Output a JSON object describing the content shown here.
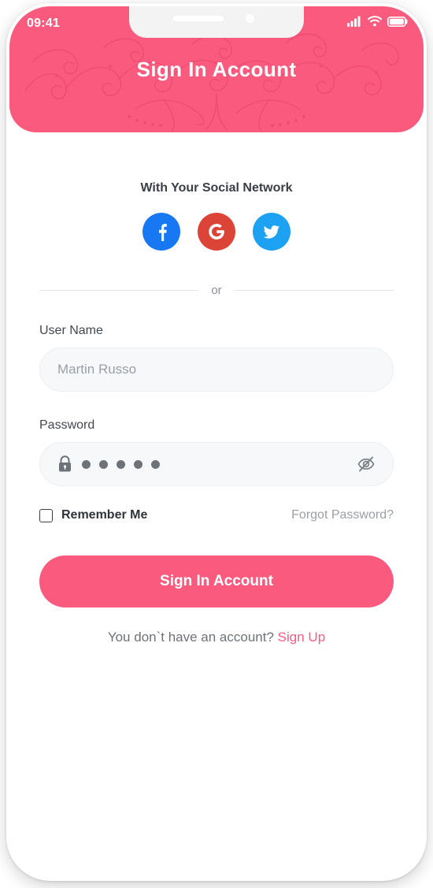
{
  "theme": {
    "accent_pink": "#FA5A7D",
    "facebook_blue": "#1877F2",
    "google_red": "#DB4437",
    "twitter_blue": "#1DA1F2",
    "input_bg": "#F6F8FA",
    "muted_text": "#9AA0A6"
  },
  "status_bar": {
    "time": "09:41",
    "icons": [
      "signal-icon",
      "wifi-icon",
      "battery-icon"
    ]
  },
  "header": {
    "title": "Sign In Account"
  },
  "social": {
    "title": "With Your Social Network",
    "buttons": [
      {
        "name": "facebook",
        "glyph": "f",
        "color": "#1877F2"
      },
      {
        "name": "google",
        "glyph": "G",
        "color": "#DB4437"
      },
      {
        "name": "twitter",
        "glyph": "twitter-bird",
        "color": "#1DA1F2"
      }
    ]
  },
  "divider": {
    "text": "or"
  },
  "form": {
    "username": {
      "label": "User Name",
      "value": "Martin Russo",
      "placeholder": "Martin Russo"
    },
    "password": {
      "label": "Password",
      "value": "•••••",
      "dot_count": 5,
      "lock_icon": "lock-icon",
      "visibility_icon": "eye-slash-icon",
      "visible": false
    },
    "remember_me": {
      "label": "Remember Me",
      "checked": false
    },
    "forgot_password": "Forgot Password?"
  },
  "actions": {
    "submit_label": "Sign In Account",
    "signup_prompt": "You don`t have an account?",
    "signup_link": "Sign Up"
  }
}
